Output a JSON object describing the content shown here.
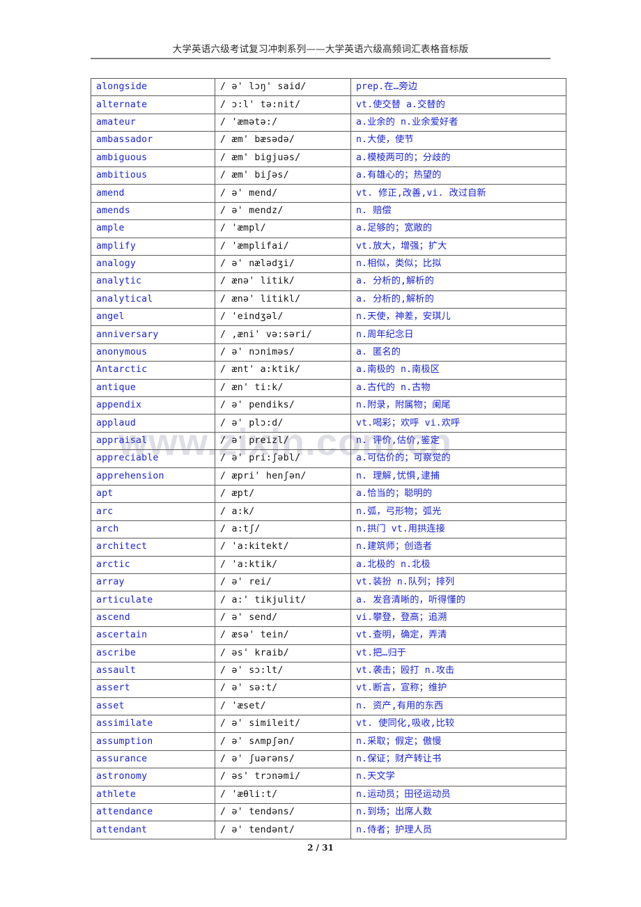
{
  "header": {
    "title": "大学英语六级考试复习冲刺系列——大学英语六级高频词汇表格音标版"
  },
  "watermark": {
    "text": "www.zixin.com.cn"
  },
  "footer": {
    "page_label": "2 / 31"
  },
  "colors": {
    "entry_blue": "#1a23d6",
    "phonetic_black": "#121212",
    "border_gray": "#595959",
    "header_rule": "#808080",
    "watermark": "#d9d9e2"
  },
  "table": {
    "columns": [
      "word",
      "phonetic",
      "meaning"
    ],
    "rows": [
      {
        "word": "alongside",
        "phonetic": "/ ə' lɔŋ' said/",
        "meaning": "prep.在…旁边"
      },
      {
        "word": "alternate",
        "phonetic": "/ ɔ:l' tə:nit/",
        "meaning": "vt.使交替 a.交替的"
      },
      {
        "word": "amateur",
        "phonetic": "/  'æmətə:/",
        "meaning": "a.业余的 n.业余爱好者"
      },
      {
        "word": "ambassador",
        "phonetic": "/ æm' bæsədə/",
        "meaning": "n.大使，使节"
      },
      {
        "word": "ambiguous",
        "phonetic": "/ æm' bigjuəs/",
        "meaning": "a.模棱两可的；分歧的"
      },
      {
        "word": "ambitious",
        "phonetic": "/ æm' biʃəs/",
        "meaning": "a.有雄心的；热望的"
      },
      {
        "word": "amend",
        "phonetic": "/ ə' mend/",
        "meaning": "vt. 修正,改善,vi. 改过自新"
      },
      {
        "word": "amends",
        "phonetic": "/ ə' mendz/",
        "meaning": "n. 赔偿"
      },
      {
        "word": "ample",
        "phonetic": "/  'æmpl/",
        "meaning": "a.足够的；宽敞的"
      },
      {
        "word": "amplify",
        "phonetic": "/  'æmplifai/",
        "meaning": "vt.放大，增强；扩大"
      },
      {
        "word": "analogy",
        "phonetic": "/ ə' nælədʒi/",
        "meaning": "n.相似，类似；比拟"
      },
      {
        "word": "analytic",
        "phonetic": "/ ænə' litik/",
        "meaning": "a. 分析的,解析的"
      },
      {
        "word": "analytical",
        "phonetic": "/ ænə' litikl/",
        "meaning": "a. 分析的,解析的"
      },
      {
        "word": "angel",
        "phonetic": "/  'eindʒəl/",
        "meaning": "n.天使，神差，安琪儿"
      },
      {
        "word": "anniversary",
        "phonetic": "/ ,æni' və:səri/",
        "meaning": "n.周年纪念日"
      },
      {
        "word": "anonymous",
        "phonetic": "/ ə' nɔniməs/",
        "meaning": "a. 匿名的"
      },
      {
        "word": "Antarctic",
        "phonetic": "/ ænt' a:ktik/",
        "meaning": "a.南极的 n.南极区"
      },
      {
        "word": "antique",
        "phonetic": "/ æn' ti:k/",
        "meaning": "a.古代的 n.古物"
      },
      {
        "word": "appendix",
        "phonetic": "/ ə' pendiks/",
        "meaning": "n.附录，附属物；阑尾"
      },
      {
        "word": "applaud",
        "phonetic": "/ ə' plɔ:d/",
        "meaning": "vt.喝彩；欢呼 vi.欢呼"
      },
      {
        "word": "appraisal",
        "phonetic": "/ ə' preizl/",
        "meaning": "n. 评价,估价,鉴定"
      },
      {
        "word": "appreciable",
        "phonetic": "/ ə' pri:ʃəbl/",
        "meaning": "a.可估价的；可察觉的"
      },
      {
        "word": "apprehension",
        "phonetic": "/ æpri' henʃən/",
        "meaning": "n. 理解,忧惧,逮捕"
      },
      {
        "word": "apt",
        "phonetic": "/ æpt/",
        "meaning": "a.恰当的；聪明的"
      },
      {
        "word": "arc",
        "phonetic": "/ a:k/",
        "meaning": "n.弧，弓形物；弧光"
      },
      {
        "word": "arch",
        "phonetic": "/ a:tʃ/",
        "meaning": "n.拱门 vt.用拱连接"
      },
      {
        "word": "architect",
        "phonetic": "/  'a:kitekt/",
        "meaning": "n.建筑师；创造者"
      },
      {
        "word": "arctic",
        "phonetic": "/  'a:ktik/",
        "meaning": "a.北极的 n.北极"
      },
      {
        "word": "array",
        "phonetic": "/ ə' rei/",
        "meaning": "vt.装扮 n.队列；排列"
      },
      {
        "word": "articulate",
        "phonetic": "/ a:' tikjulit/",
        "meaning": "a. 发音清晰的，听得懂的"
      },
      {
        "word": "ascend",
        "phonetic": "/ ə' send/",
        "meaning": "vi.攀登，登高；追溯"
      },
      {
        "word": "ascertain",
        "phonetic": "/ æsə' tein/",
        "meaning": "vt.查明，确定，弄清"
      },
      {
        "word": "ascribe",
        "phonetic": "/ əs' kraib/",
        "meaning": "vt.把…归于"
      },
      {
        "word": "assault",
        "phonetic": "/ ə' sɔ:lt/",
        "meaning": "vt.袭击；殴打 n.攻击"
      },
      {
        "word": "assert",
        "phonetic": "/ ə' sə:t/",
        "meaning": "vt.断言，宣称；维护"
      },
      {
        "word": "asset",
        "phonetic": "/  'æset/",
        "meaning": "n. 资产,有用的东西"
      },
      {
        "word": "assimilate",
        "phonetic": "/ ə' simileit/",
        "meaning": "vt. 使同化,吸收,比较"
      },
      {
        "word": "assumption",
        "phonetic": "/ ə' sʌmpʃən/",
        "meaning": "n.采取；假定；傲慢"
      },
      {
        "word": "assurance",
        "phonetic": "/ ə' ʃuərəns/",
        "meaning": "n.保证；财产转让书"
      },
      {
        "word": "astronomy",
        "phonetic": "/ əs' trɔnəmi/",
        "meaning": "n.天文学"
      },
      {
        "word": "athlete",
        "phonetic": "/  'æθli:t/",
        "meaning": "n.运动员；田径运动员"
      },
      {
        "word": "attendance",
        "phonetic": "/ ə' tendəns/",
        "meaning": "n.到场；出席人数"
      },
      {
        "word": "attendant",
        "phonetic": "/ ə' tendənt/",
        "meaning": "n.侍者；护理人员"
      }
    ]
  }
}
